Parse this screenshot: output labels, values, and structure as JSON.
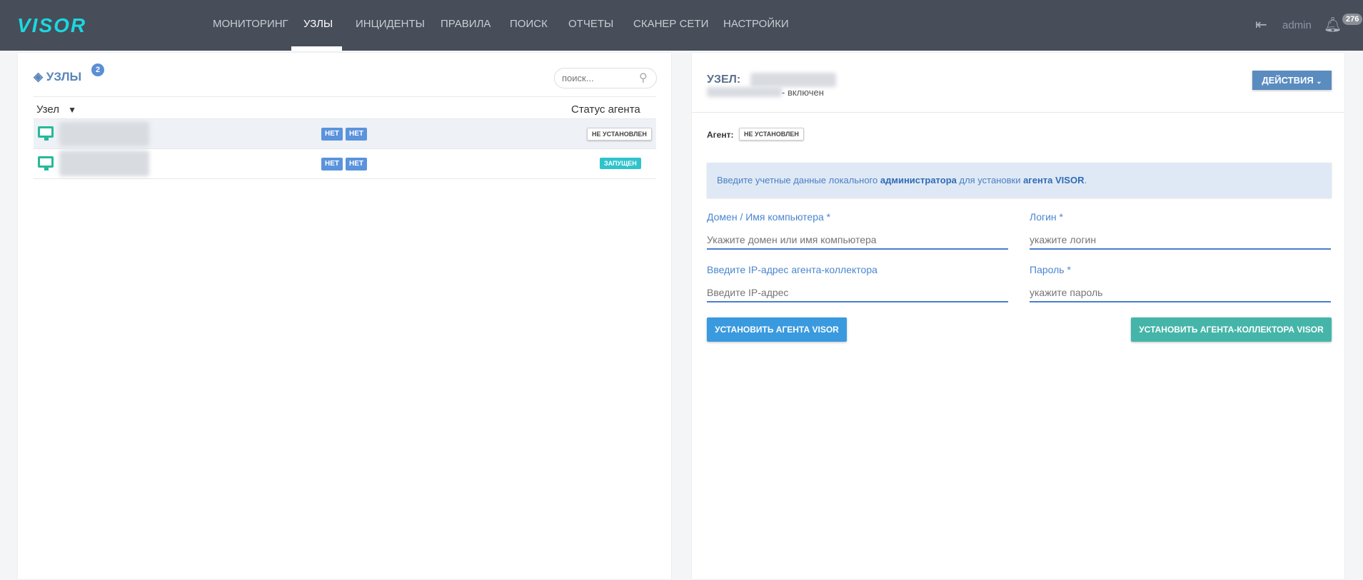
{
  "header": {
    "logo": "VISOR",
    "nav": [
      "МОНИТОРИНГ",
      "УЗЛЫ",
      "ИНЦИДЕНТЫ",
      "ПРАВИЛА",
      "ПОИСК",
      "ОТЧЕТЫ",
      "СКАНЕР СЕТИ",
      "НАСТРОЙКИ"
    ],
    "active": "УЗЛЫ",
    "user": "admin",
    "notifications": "276"
  },
  "nodes": {
    "title": "УЗЛЫ",
    "count": "2",
    "search_placeholder": "поиск...",
    "col_node": "Узел",
    "col_status": "Статус агента",
    "rows": [
      {
        "flag1": "НЕТ",
        "flag2": "НЕТ",
        "status": "НЕ УСТАНОВЛЕН"
      },
      {
        "flag1": "НЕТ",
        "flag2": "НЕТ",
        "status": "ЗАПУЩЕН"
      }
    ]
  },
  "detail": {
    "title": "УЗЕЛ:",
    "state": "- включен",
    "actions": "ДЕЙСТВИЯ",
    "agent_label": "Агент:",
    "agent_status": "НЕ УСТАНОВЛЕН",
    "info_pre": "Введите учетные данные локального ",
    "info_b1": "администратора",
    "info_mid": " для установки ",
    "info_b2": "агента VISOR",
    "info_end": ".",
    "domain_label": "Домен / Имя компьютера *",
    "domain_placeholder": "Укажите домен или имя компьютера",
    "login_label": "Логин *",
    "login_placeholder": "укажите логин",
    "ip_label": "Введите IP-адрес агента-коллектора",
    "ip_placeholder": "Введите IP-адрес",
    "password_label": "Пароль *",
    "password_placeholder": "укажите пароль",
    "install_agent": "УСТАНОВИТЬ АГЕНТА VISOR",
    "install_collector": "УСТАНОВИТЬ АГЕНТА-КОЛЛЕКТОРА VISOR"
  },
  "colors": {
    "header": "#474d59",
    "accent": "#5a8cc0",
    "teal": "#45b5a9",
    "blue": "#3a9ae0"
  }
}
